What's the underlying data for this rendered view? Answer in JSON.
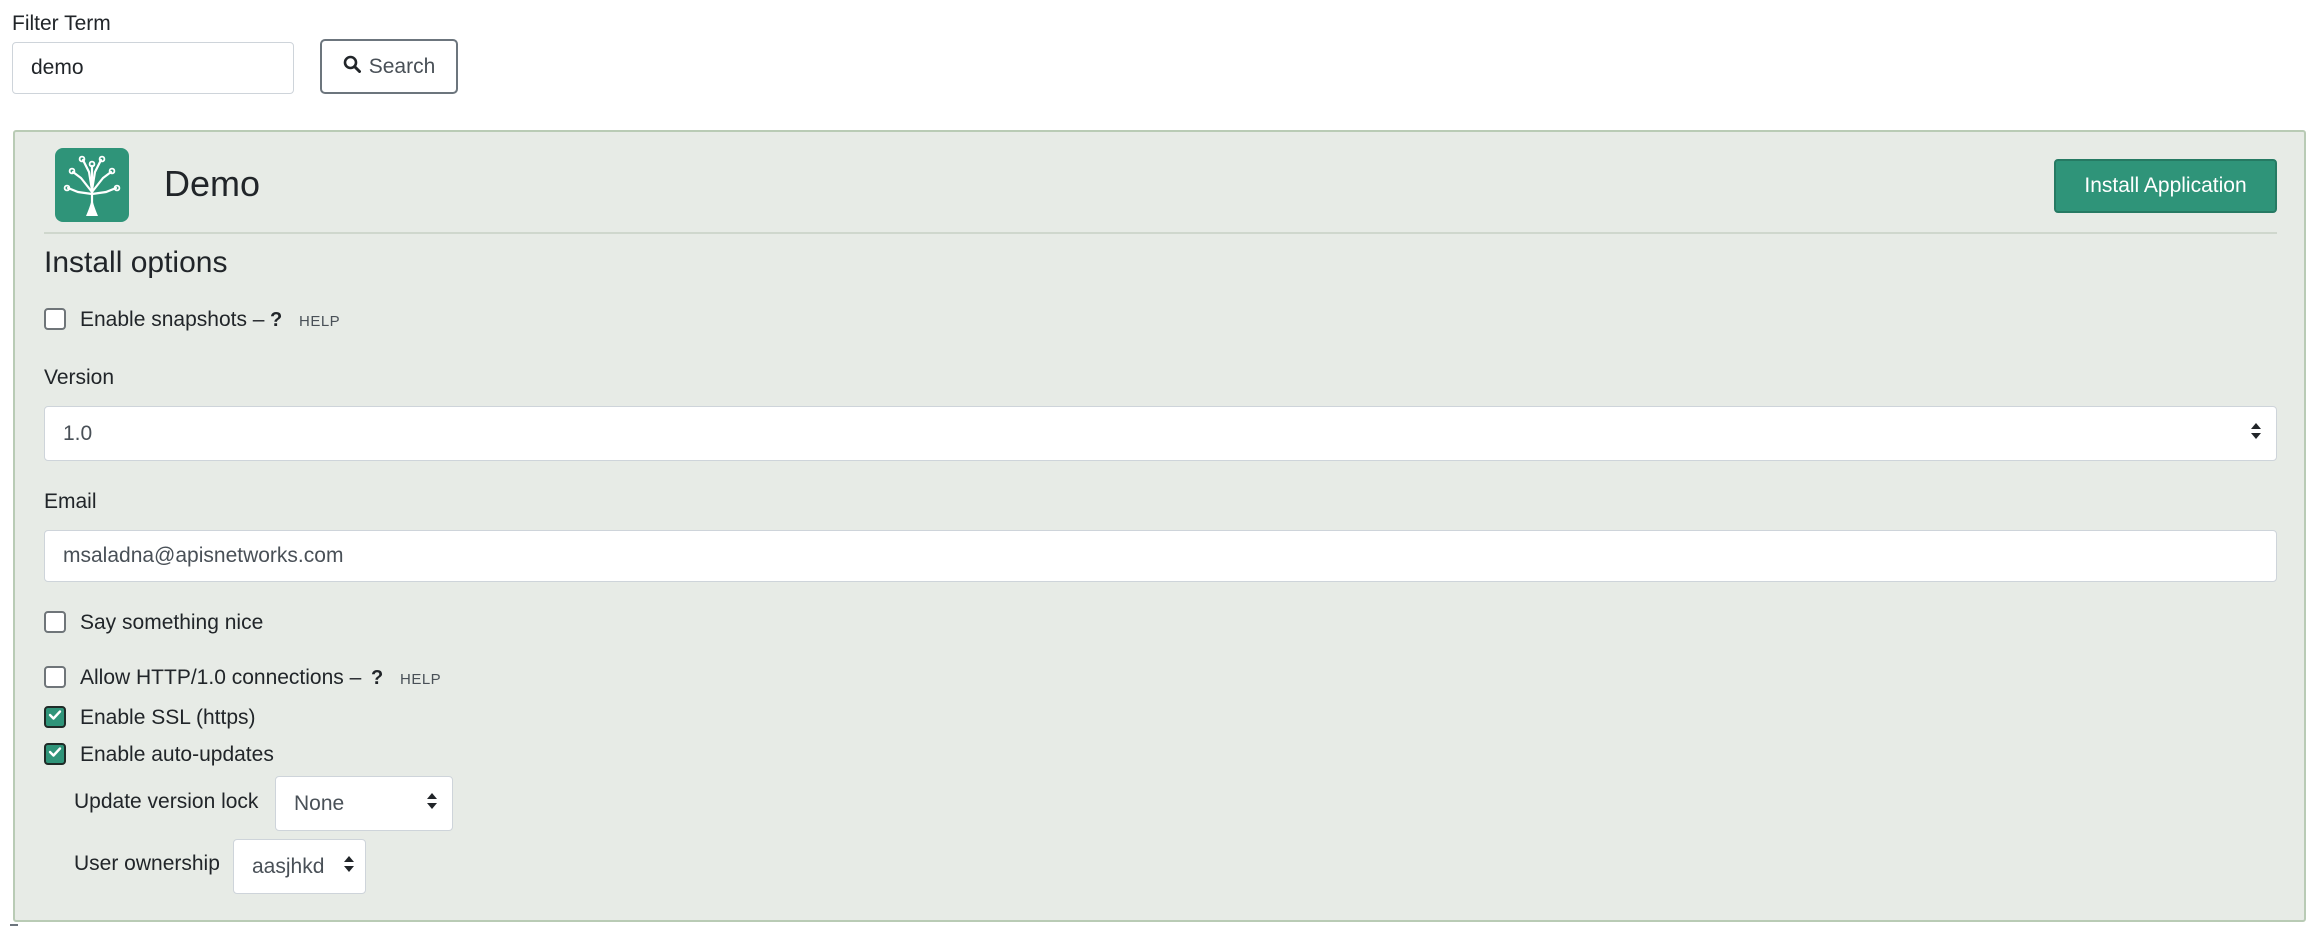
{
  "filter": {
    "label": "Filter Term",
    "value": "demo",
    "search_label": "Search"
  },
  "app": {
    "title": "Demo",
    "install_label": "Install Application",
    "logo_icon": "tree-icon",
    "accent_color": "#2f9479"
  },
  "options": {
    "title": "Install options",
    "snapshots": {
      "label": "Enable snapshots –",
      "checked": false,
      "help_q": "?",
      "help_text": "HELP"
    },
    "version": {
      "label": "Version",
      "value": "1.0"
    },
    "email": {
      "label": "Email",
      "value": "msaladna@apisnetworks.com"
    },
    "say_nice": {
      "label": "Say something nice",
      "checked": false
    },
    "http10": {
      "label": "Allow HTTP/1.0 connections –",
      "checked": false,
      "help_q": "?",
      "help_text": "HELP"
    },
    "ssl": {
      "label": "Enable SSL (https)",
      "checked": true
    },
    "autoupdates": {
      "label": "Enable auto-updates",
      "checked": true
    },
    "version_lock": {
      "label": "Update version lock",
      "value": "None"
    },
    "ownership": {
      "label": "User ownership",
      "value": "aasjhkd"
    }
  }
}
